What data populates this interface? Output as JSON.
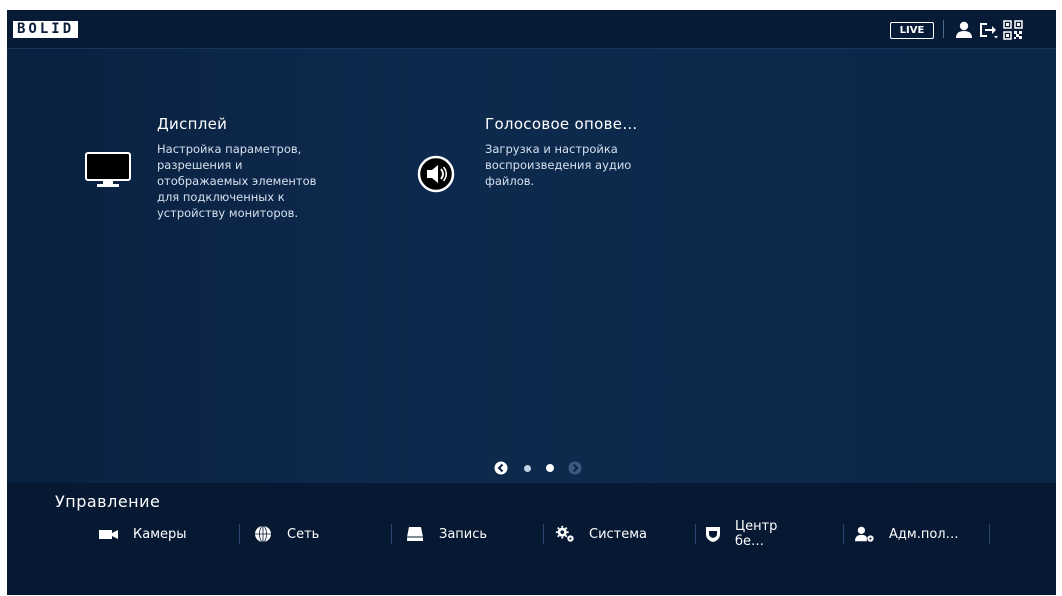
{
  "header": {
    "logo_text": "BOLID",
    "live_label": "LIVE",
    "icons": [
      "user-icon",
      "logout-icon",
      "qr-code-icon"
    ]
  },
  "cards": [
    {
      "title": "Дисплей",
      "description": "Настройка параметров,\nразрешения и\nотображаемых элементов\nдля подключенных к\nустройству мониторов.",
      "icon": "monitor-icon"
    },
    {
      "title": "Голосовое опове…",
      "description": "Загрузка и настройка\nвоспроизведения аудио\nфайлов.",
      "icon": "speaker-icon"
    }
  ],
  "pager": {
    "current_page": 2,
    "total_pages": 2
  },
  "management": {
    "title": "Управление",
    "items": [
      {
        "label": "Камеры",
        "icon": "camera-icon"
      },
      {
        "label": "Сеть",
        "icon": "network-globe-icon"
      },
      {
        "label": "Запись",
        "icon": "hdd-icon"
      },
      {
        "label": "Система",
        "icon": "gears-icon"
      },
      {
        "label": "Центр бе…",
        "icon": "shield-icon"
      },
      {
        "label": "Адм.пол…",
        "icon": "user-settings-icon"
      }
    ]
  },
  "colors": {
    "background": "#0b2444",
    "header": "#081b36",
    "bottom_panel": "#071833",
    "text": "#ffffff"
  }
}
